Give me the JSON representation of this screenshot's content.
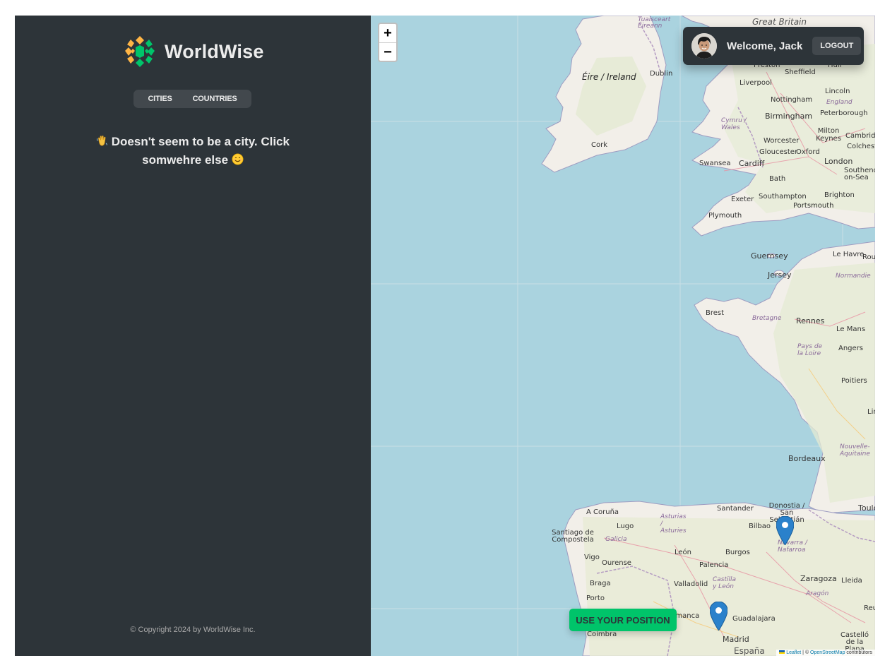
{
  "app": {
    "name": "WorldWise"
  },
  "sidebar": {
    "nav": [
      {
        "label": "CITIES"
      },
      {
        "label": "COUNTRIES"
      }
    ],
    "message": "Doesn't seem to be a city. Click somwehre else",
    "message_emoji_start": "waving-hand",
    "message_emoji_end": "smiling-face",
    "footer": "© Copyright 2024 by WorldWise Inc."
  },
  "map": {
    "zoom_in": "+",
    "zoom_out": "−",
    "places": [
      {
        "name": "Great Britain",
        "kind": "country"
      },
      {
        "name": "Tuaisceart Éireann",
        "kind": "region"
      },
      {
        "name": "Éire / Ireland",
        "kind": "country"
      },
      {
        "name": "Dublin",
        "kind": "city"
      },
      {
        "name": "Cork",
        "kind": "city"
      },
      {
        "name": "Preston",
        "kind": "city"
      },
      {
        "name": "Hull",
        "kind": "city"
      },
      {
        "name": "Sheffield",
        "kind": "city"
      },
      {
        "name": "Liverpool",
        "kind": "city"
      },
      {
        "name": "Nottingham",
        "kind": "city"
      },
      {
        "name": "Lincoln",
        "kind": "city"
      },
      {
        "name": "England",
        "kind": "region"
      },
      {
        "name": "Birmingham",
        "kind": "city"
      },
      {
        "name": "Peterborough",
        "kind": "city"
      },
      {
        "name": "Cymru / Wales",
        "kind": "region"
      },
      {
        "name": "Milton Keynes",
        "kind": "city"
      },
      {
        "name": "Cambridge",
        "kind": "city"
      },
      {
        "name": "Worcester",
        "kind": "city"
      },
      {
        "name": "Colchester",
        "kind": "city"
      },
      {
        "name": "Gloucester",
        "kind": "city"
      },
      {
        "name": "Oxford",
        "kind": "city"
      },
      {
        "name": "Swansea",
        "kind": "city"
      },
      {
        "name": "Cardiff",
        "kind": "city"
      },
      {
        "name": "London",
        "kind": "city"
      },
      {
        "name": "Southend-on-Sea",
        "kind": "city"
      },
      {
        "name": "Bath",
        "kind": "city"
      },
      {
        "name": "Exeter",
        "kind": "city"
      },
      {
        "name": "Southampton",
        "kind": "city"
      },
      {
        "name": "Brighton",
        "kind": "city"
      },
      {
        "name": "Portsmouth",
        "kind": "city"
      },
      {
        "name": "Plymouth",
        "kind": "city"
      },
      {
        "name": "Guernsey",
        "kind": "country"
      },
      {
        "name": "Jersey",
        "kind": "country"
      },
      {
        "name": "Le Havre",
        "kind": "city"
      },
      {
        "name": "Rouen",
        "kind": "city"
      },
      {
        "name": "Normandie",
        "kind": "region"
      },
      {
        "name": "Brest",
        "kind": "city"
      },
      {
        "name": "Bretagne",
        "kind": "region"
      },
      {
        "name": "Rennes",
        "kind": "city"
      },
      {
        "name": "Le Mans",
        "kind": "city"
      },
      {
        "name": "Pays de la Loire",
        "kind": "region"
      },
      {
        "name": "Angers",
        "kind": "city"
      },
      {
        "name": "Poitiers",
        "kind": "city"
      },
      {
        "name": "Limoges",
        "kind": "city"
      },
      {
        "name": "Nouvelle-Aquitaine",
        "kind": "region"
      },
      {
        "name": "Bordeaux",
        "kind": "city"
      },
      {
        "name": "Toulouse",
        "kind": "city"
      },
      {
        "name": "A Coruña",
        "kind": "city"
      },
      {
        "name": "Santander",
        "kind": "city"
      },
      {
        "name": "Donostia / San Sebastián",
        "kind": "city"
      },
      {
        "name": "Asturias / Asturies",
        "kind": "region"
      },
      {
        "name": "Lugo",
        "kind": "city"
      },
      {
        "name": "Bilbao",
        "kind": "city"
      },
      {
        "name": "Santiago de Compostela",
        "kind": "city"
      },
      {
        "name": "Galicia",
        "kind": "region"
      },
      {
        "name": "Navarra / Nafarroa",
        "kind": "region"
      },
      {
        "name": "León",
        "kind": "city"
      },
      {
        "name": "Vigo",
        "kind": "city"
      },
      {
        "name": "Ourense",
        "kind": "city"
      },
      {
        "name": "Burgos",
        "kind": "city"
      },
      {
        "name": "Palencia",
        "kind": "city"
      },
      {
        "name": "Zaragoza",
        "kind": "city"
      },
      {
        "name": "Braga",
        "kind": "city"
      },
      {
        "name": "Valladolid",
        "kind": "city"
      },
      {
        "name": "Castilla y León",
        "kind": "region"
      },
      {
        "name": "Lleida",
        "kind": "city"
      },
      {
        "name": "Aragón",
        "kind": "region"
      },
      {
        "name": "Porto",
        "kind": "city"
      },
      {
        "name": "Salamanca",
        "kind": "city"
      },
      {
        "name": "Guadalajara",
        "kind": "city"
      },
      {
        "name": "Reus",
        "kind": "city"
      },
      {
        "name": "Coimbra",
        "kind": "city"
      },
      {
        "name": "Madrid",
        "kind": "city"
      },
      {
        "name": "Castelló de la Plana",
        "kind": "city"
      },
      {
        "name": "España",
        "kind": "country"
      }
    ],
    "markers": [
      {
        "name": "marker-pamplona"
      },
      {
        "name": "marker-madrid"
      }
    ],
    "attribution": {
      "leaflet": "Leaflet",
      "sep": " | © ",
      "osm": "OpenStreetMap",
      "suffix": " contributors"
    }
  },
  "user": {
    "welcome": "Welcome, Jack",
    "logout": "LOGOUT"
  },
  "position_button": "USE YOUR POSITION",
  "colors": {
    "sidebar_bg": "#2d3439",
    "panel_bg": "#42484d",
    "text_light": "#ececec",
    "brand_green": "#00c46a",
    "brand_yellow": "#ffb545",
    "water": "#aad3df",
    "land": "#f2efe9",
    "marker_blue": "#2a81cb"
  }
}
